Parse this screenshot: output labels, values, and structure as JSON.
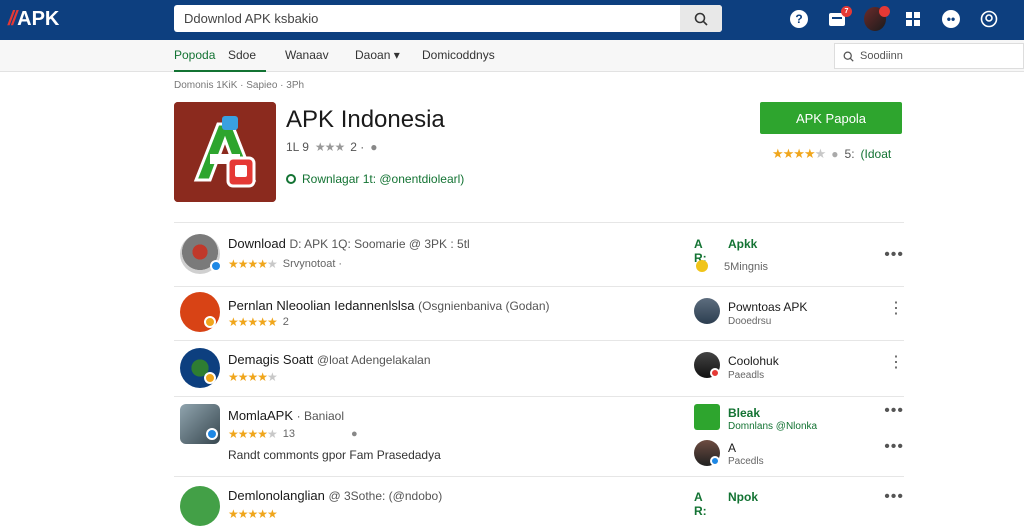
{
  "topbar": {
    "logo_mark": "//",
    "logo_text": "APK",
    "search_value": "Ddownlod APK ksbakio",
    "notification_count": "7"
  },
  "subnav": {
    "tabs": [
      "Popoda",
      "Sdoe",
      "Wanaav",
      "Daoan",
      "Domicoddnys"
    ],
    "search_placeholder": "Soodiinn"
  },
  "breadcrumb": "Domonis 1KiK · Sapieo · 3Ph",
  "app": {
    "title": "APK Indonesia",
    "rating_prefix": "1L 9",
    "rating_suffix": "2 ·",
    "developer_label": "Rownlagar 1t: @onentdiolearl)",
    "install_label": "APK Papola",
    "rating_right_value": "5:",
    "rating_right_label": "(Idoat"
  },
  "rows": [
    {
      "title": "Download",
      "title_muted": "D: APK 1Q: Soomarie @ 3PK : 5tl",
      "sub": "Srvynotoat ·",
      "right_tag": "A R:",
      "right_title": "Apkk",
      "right_sub": "5Mingnis"
    },
    {
      "title": "Pernlan Nleoolian Iedannenlslsa",
      "title_muted": "(Osgnienbaniva (Godan)",
      "sub": "2",
      "right_title": "Powntoas APK",
      "right_sub": "Dooedrsu"
    },
    {
      "title": "Demagis Soatt",
      "title_muted": "@loat Adengelakalan",
      "sub": "",
      "right_title": "Coolohuk",
      "right_sub": "Paeadls"
    },
    {
      "title": "MomlaAPK",
      "title_muted": "· Baniaol",
      "sub": "13",
      "extra": "Randt commonts gpor Fam Prasedadya",
      "right_title": "Bleak",
      "right_sub": "Domnlans @Nlonka",
      "right_title2": "A",
      "right_sub2": "Pacedls"
    },
    {
      "title": "Demlonolanglian",
      "title_muted": "@ 3Sothe: (@ndobo)",
      "sub": "",
      "right_tag": "A R:",
      "right_title": "Npok",
      "right_sub": ""
    }
  ],
  "colors": {
    "topbar": "#0d3f7f",
    "accent_green": "#2ea52e",
    "link_green": "#137333",
    "star": "#f0a61c"
  }
}
